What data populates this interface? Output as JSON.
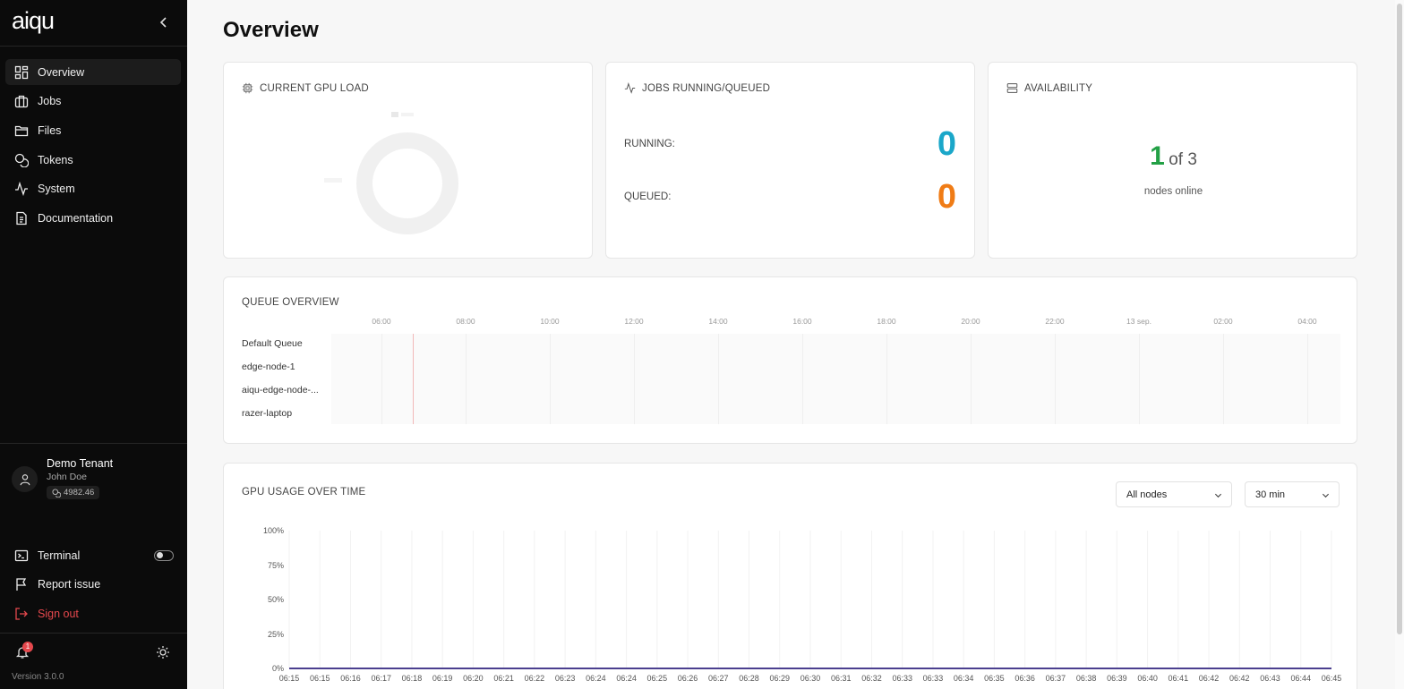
{
  "sidebar": {
    "logo": "aiqu",
    "nav": [
      {
        "label": "Overview",
        "icon": "grid-icon",
        "active": true
      },
      {
        "label": "Jobs",
        "icon": "briefcase-icon"
      },
      {
        "label": "Files",
        "icon": "folder-icon"
      },
      {
        "label": "Tokens",
        "icon": "coins-icon"
      },
      {
        "label": "System",
        "icon": "activity-icon"
      },
      {
        "label": "Documentation",
        "icon": "document-icon"
      }
    ],
    "user": {
      "tenant": "Demo Tenant",
      "name": "John Doe",
      "credits": "4982.46"
    },
    "bottom": {
      "terminal": "Terminal",
      "report": "Report issue",
      "signout": "Sign out"
    },
    "notification_count": "1",
    "version": "Version 3.0.0"
  },
  "main": {
    "title": "Overview",
    "gpu_load": {
      "title": "CURRENT GPU LOAD"
    },
    "jobs": {
      "title": "JOBS RUNNING/QUEUED",
      "running_label": "RUNNING:",
      "running": "0",
      "queued_label": "QUEUED:",
      "queued": "0"
    },
    "availability": {
      "title": "AVAILABILITY",
      "online": "1",
      "of_total": "of 3",
      "subtitle": "nodes online"
    },
    "queue": {
      "title": "QUEUE OVERVIEW",
      "ticks": [
        "06:00",
        "08:00",
        "10:00",
        "12:00",
        "14:00",
        "16:00",
        "18:00",
        "20:00",
        "22:00",
        "13 sep.",
        "02:00",
        "04:00"
      ],
      "rows": [
        "Default Queue",
        "edge-node-1",
        "aiqu-edge-node-...",
        "razer-laptop"
      ]
    },
    "gpu_usage": {
      "title": "GPU USAGE OVER TIME",
      "node_select": "All nodes",
      "range_select": "30 min"
    }
  },
  "chart_data": {
    "type": "line",
    "title": "GPU USAGE OVER TIME",
    "x": [
      "06:15",
      "06:15",
      "06:16",
      "06:17",
      "06:18",
      "06:19",
      "06:20",
      "06:21",
      "06:22",
      "06:23",
      "06:24",
      "06:24",
      "06:25",
      "06:26",
      "06:27",
      "06:28",
      "06:29",
      "06:30",
      "06:31",
      "06:32",
      "06:33",
      "06:33",
      "06:34",
      "06:35",
      "06:36",
      "06:37",
      "06:38",
      "06:39",
      "06:40",
      "06:41",
      "06:42",
      "06:42",
      "06:43",
      "06:44",
      "06:45"
    ],
    "y_ticks": [
      "100%",
      "75%",
      "50%",
      "25%",
      "0%"
    ],
    "ylim": [
      0,
      100
    ],
    "series": [
      {
        "values": [
          0,
          0,
          0,
          0,
          0,
          0,
          0,
          0,
          0,
          0,
          0,
          0,
          0,
          0,
          0,
          0,
          0,
          0,
          0,
          0,
          0,
          0,
          0,
          0,
          0,
          0,
          0,
          0,
          0,
          0,
          0,
          0,
          0,
          0,
          0
        ]
      }
    ],
    "line_color": "#4b3f8f",
    "grid": true
  },
  "colors": {
    "running": "#1ba7c9",
    "queued": "#f07c16",
    "online": "#22a045",
    "signout": "#e5484d"
  }
}
